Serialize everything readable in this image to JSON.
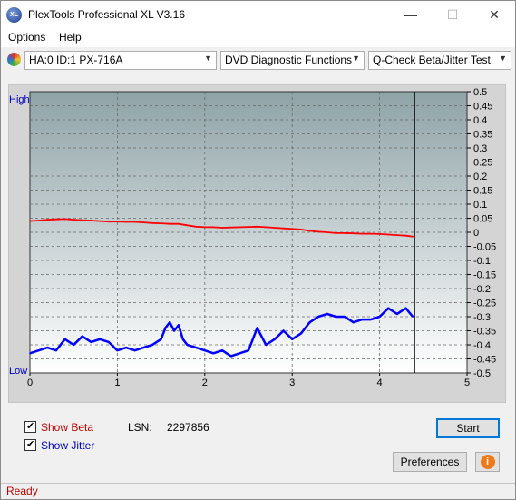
{
  "window": {
    "title": "PlexTools Professional XL V3.16",
    "icon_text": "XL",
    "minimize_glyph": "—",
    "maximize_glyph": "☐",
    "close_glyph": "✕"
  },
  "menu": {
    "items": [
      "Options",
      "Help"
    ]
  },
  "toolbar": {
    "drive": "HA:0 ID:1  PX-716A",
    "function": "DVD Diagnostic Functions",
    "test": "Q-Check Beta/Jitter Test"
  },
  "chart_labels": {
    "high": "High",
    "low": "Low"
  },
  "chart_data": {
    "type": "line",
    "x_ticks": [
      "0",
      "1",
      "2",
      "3",
      "4",
      "5"
    ],
    "xlim": [
      0,
      5
    ],
    "right_ticks": [
      "0.5",
      "0.45",
      "0.4",
      "0.35",
      "0.3",
      "0.25",
      "0.2",
      "0.15",
      "0.1",
      "0.05",
      "0",
      "-0.05",
      "-0.1",
      "-0.15",
      "-0.2",
      "-0.25",
      "-0.3",
      "-0.35",
      "-0.4",
      "-0.45",
      "-0.5"
    ],
    "ylim": [
      -0.5,
      0.5
    ],
    "grid": true,
    "marker_x": 4.4,
    "series": [
      {
        "color": "#ff0000",
        "x": [
          0,
          0.1,
          0.2,
          0.3,
          0.4,
          0.5,
          0.6,
          0.7,
          0.8,
          0.9,
          1.0,
          1.1,
          1.2,
          1.3,
          1.4,
          1.5,
          1.6,
          1.7,
          1.8,
          1.9,
          2.0,
          2.1,
          2.2,
          2.3,
          2.4,
          2.5,
          2.6,
          2.7,
          2.8,
          2.9,
          3.0,
          3.1,
          3.2,
          3.3,
          3.4,
          3.5,
          3.6,
          3.7,
          3.8,
          3.9,
          4.0,
          4.1,
          4.2,
          4.3,
          4.38
        ],
        "values": [
          0.04,
          0.042,
          0.045,
          0.046,
          0.047,
          0.045,
          0.043,
          0.042,
          0.04,
          0.038,
          0.038,
          0.037,
          0.037,
          0.035,
          0.033,
          0.032,
          0.03,
          0.03,
          0.025,
          0.02,
          0.018,
          0.018,
          0.016,
          0.017,
          0.018,
          0.019,
          0.02,
          0.018,
          0.016,
          0.014,
          0.012,
          0.01,
          0.005,
          0.002,
          0.0,
          -0.003,
          -0.003,
          -0.004,
          -0.005,
          -0.005,
          -0.006,
          -0.008,
          -0.01,
          -0.012,
          -0.015
        ]
      },
      {
        "color": "#0000ff",
        "x": [
          0,
          0.1,
          0.2,
          0.3,
          0.4,
          0.5,
          0.6,
          0.7,
          0.8,
          0.9,
          1.0,
          1.1,
          1.2,
          1.3,
          1.4,
          1.5,
          1.55,
          1.6,
          1.65,
          1.7,
          1.75,
          1.8,
          1.9,
          2.0,
          2.1,
          2.2,
          2.3,
          2.4,
          2.5,
          2.55,
          2.6,
          2.7,
          2.8,
          2.9,
          3.0,
          3.1,
          3.2,
          3.3,
          3.4,
          3.5,
          3.6,
          3.7,
          3.8,
          3.9,
          4.0,
          4.1,
          4.2,
          4.3,
          4.38
        ],
        "values": [
          -0.43,
          -0.42,
          -0.41,
          -0.42,
          -0.38,
          -0.4,
          -0.37,
          -0.39,
          -0.38,
          -0.39,
          -0.42,
          -0.41,
          -0.42,
          -0.41,
          -0.4,
          -0.38,
          -0.34,
          -0.32,
          -0.35,
          -0.33,
          -0.38,
          -0.4,
          -0.41,
          -0.42,
          -0.43,
          -0.42,
          -0.44,
          -0.43,
          -0.42,
          -0.38,
          -0.34,
          -0.4,
          -0.38,
          -0.35,
          -0.38,
          -0.36,
          -0.32,
          -0.3,
          -0.29,
          -0.3,
          -0.3,
          -0.32,
          -0.31,
          -0.31,
          -0.3,
          -0.27,
          -0.29,
          -0.27,
          -0.3
        ]
      }
    ]
  },
  "bottom": {
    "show_beta_label": "Show Beta",
    "show_jitter_label": "Show Jitter",
    "lsn_label": "LSN:",
    "lsn_value": "2297856",
    "start_label": "Start",
    "preferences_label": "Preferences",
    "info_glyph": "i"
  },
  "status": {
    "text": "Ready"
  },
  "colors": {
    "beta_label": "#c00000",
    "jitter_label": "#0000c0",
    "beta_line": "#ff0000",
    "jitter_line": "#0000ff",
    "status_text": "#c00000"
  }
}
